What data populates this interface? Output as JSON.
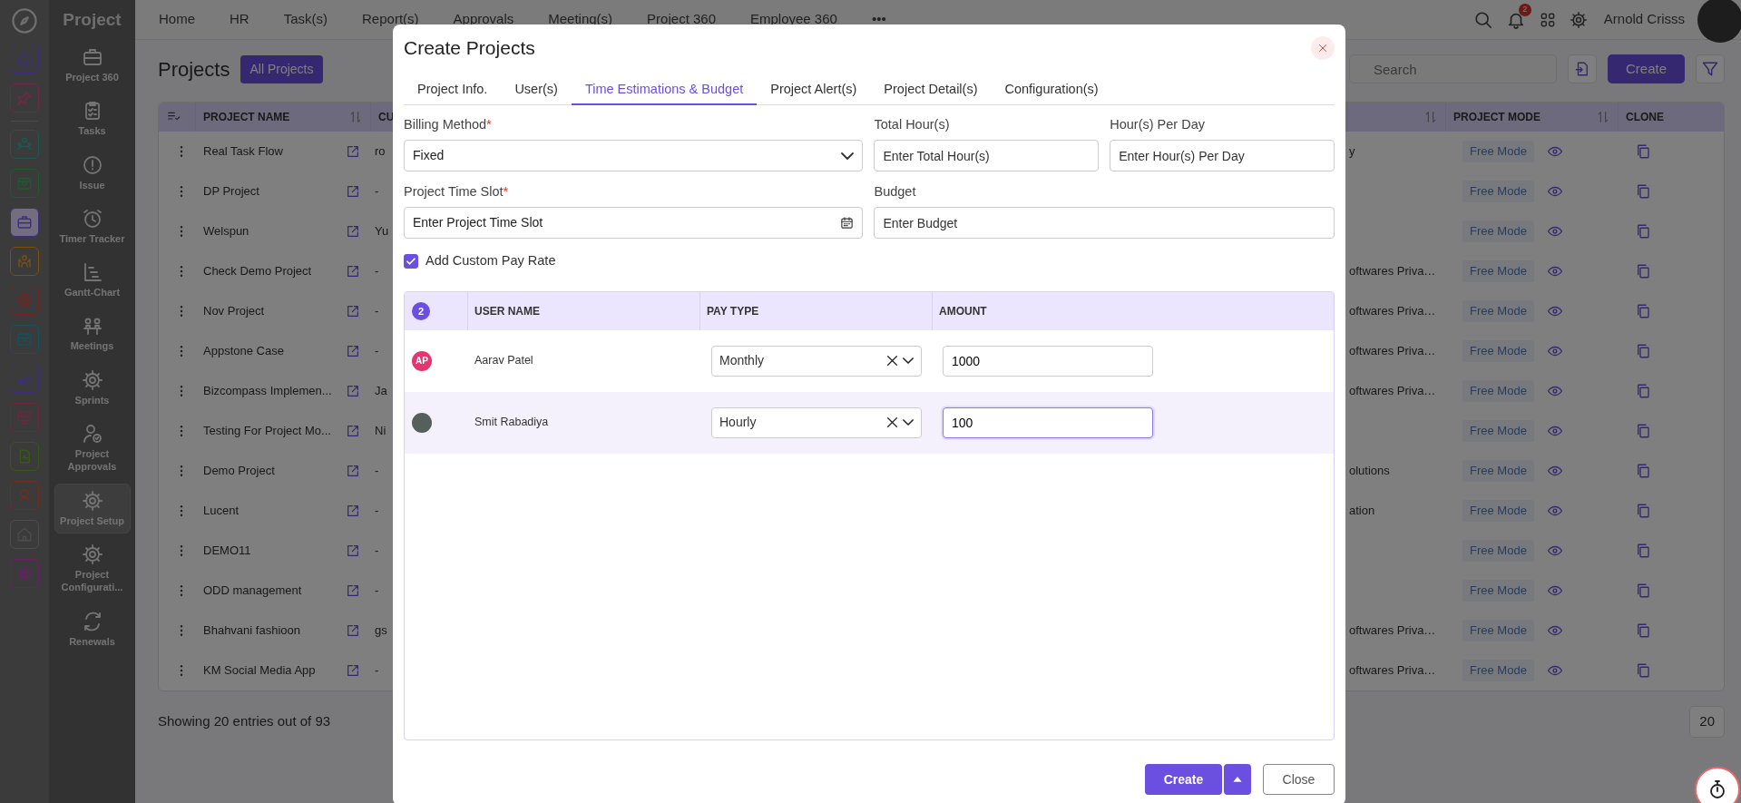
{
  "app": {
    "title": "Project"
  },
  "module_rail": [
    {
      "selected": false
    },
    {
      "selected": false
    },
    {
      "selected": false
    },
    {
      "selected": false
    },
    {
      "selected": true
    },
    {
      "selected": false
    },
    {
      "selected": false
    },
    {
      "selected": false
    },
    {
      "selected": false
    },
    {
      "selected": false
    },
    {
      "selected": false
    },
    {
      "selected": false
    },
    {
      "selected": false
    },
    {
      "selected": false
    }
  ],
  "sidebar": [
    {
      "label": "Project 360",
      "selected": false
    },
    {
      "label": "Tasks",
      "selected": false
    },
    {
      "label": "Issue",
      "selected": false
    },
    {
      "label": "Timer Tracker",
      "selected": false
    },
    {
      "label": "Gantt-Chart",
      "selected": false
    },
    {
      "label": "Meetings",
      "selected": false
    },
    {
      "label": "Sprints",
      "selected": false
    },
    {
      "label": "Project Approvals",
      "selected": false
    },
    {
      "label": "Project Setup",
      "selected": true
    },
    {
      "label": "Project Configurati...",
      "selected": false
    },
    {
      "label": "Renewals",
      "selected": false
    }
  ],
  "nav": [
    "Home",
    "HR",
    "Task(s)",
    "Report(s)",
    "Approvals",
    "Meeting(s)",
    "Project 360",
    "Employee 360"
  ],
  "nav_more": "•••",
  "user": {
    "name": "Arnold Crisss",
    "notifications": "2"
  },
  "page": {
    "title": "Projects",
    "filter": "All Projects",
    "search_placeholder": "Search",
    "create": "Create"
  },
  "table": {
    "header": {
      "project_name": "PROJECT NAME",
      "column_3": "CU",
      "project_mode": "PROJECT MODE",
      "clone": "CLONE"
    },
    "rows": [
      {
        "name": "Real Task Flow",
        "column_3": "ro",
        "column_4": "y",
        "mode": "Free Mode"
      },
      {
        "name": "DP Project",
        "column_3": "-",
        "mode": "Free Mode"
      },
      {
        "name": "Welspun",
        "column_3": "Yu",
        "mode": "Free Mode"
      },
      {
        "name": "Check Demo Project",
        "column_3": "-",
        "column_4": "oftwares Priva…",
        "mode": "Free Mode"
      },
      {
        "name": "Nov Project",
        "column_3": "-",
        "column_4": "oftwares Priva…",
        "mode": "Free Mode"
      },
      {
        "name": "Appstone Case",
        "column_3": "-",
        "column_4": "oftwares Priva…",
        "mode": "Free Mode"
      },
      {
        "name": "Bizcompass Implemen...",
        "column_3": "Ja",
        "column_4": "oftwares Priva…",
        "mode": "Free Mode"
      },
      {
        "name": "Testing For Project Mo...",
        "column_3": "Ni",
        "mode": "Free Mode"
      },
      {
        "name": "Demo Project",
        "column_3": "-",
        "column_4": "olutions",
        "mode": "Free Mode"
      },
      {
        "name": "Lucent",
        "column_3": "-",
        "column_4": "ation",
        "mode": "Free Mode"
      },
      {
        "name": "DEMO11",
        "column_3": "-",
        "mode": "Free Mode"
      },
      {
        "name": "ODD management",
        "column_3": "-",
        "mode": "Free Mode"
      },
      {
        "name": "Bhahvani fashioon",
        "column_3": "gs",
        "column_4": "oftwares Priva…",
        "mode": "Free Mode"
      },
      {
        "name": "KM Social Media App",
        "column_3": "-",
        "column_4": "oftwares Priva…",
        "mode": "Free Mode"
      }
    ]
  },
  "footer": {
    "summary": "Showing 20 entries out of 93",
    "page_size": "20"
  },
  "modal": {
    "title": "Create Projects",
    "tabs": [
      {
        "label": "Project Info.",
        "selected": false
      },
      {
        "label": "User(s)",
        "selected": false
      },
      {
        "label": "Time Estimations & Budget",
        "selected": true
      },
      {
        "label": "Project Alert(s)",
        "selected": false
      },
      {
        "label": "Project Detail(s)",
        "selected": false
      },
      {
        "label": "Configuration(s)",
        "selected": false
      }
    ],
    "fields": [
      {
        "kind": "select",
        "label": "Billing Method",
        "required_mark": "*",
        "value": "Fixed"
      },
      {
        "kind": "input",
        "label": "Total Hour(s)",
        "placeholder": "Enter Total Hour(s)"
      },
      {
        "kind": "input",
        "label": "Hour(s) Per Day",
        "placeholder": "Enter Hour(s) Per Day"
      },
      {
        "kind": "date",
        "label": "Project Time Slot",
        "required_mark": "*",
        "placeholder": "Enter Project Time Slot"
      },
      {
        "kind": "input",
        "label": "Budget",
        "placeholder": "Enter Budget"
      }
    ],
    "custom_pay": {
      "label": "Add Custom Pay Rate",
      "checked": true
    },
    "pay_table": {
      "count": "2",
      "columns": [
        "USER NAME",
        "PAY TYPE",
        "AMOUNT"
      ],
      "rows": [
        {
          "kind": "initials",
          "initials": "AP",
          "name": "Aarav Patel",
          "pay_type": "Monthly",
          "amount": "1000",
          "selected": false
        },
        {
          "kind": "photo",
          "name": "Smit Rabadiya",
          "pay_type": "Hourly",
          "amount": "100",
          "selected": true
        }
      ]
    },
    "buttons": {
      "create": "Create",
      "close": "Close"
    }
  }
}
